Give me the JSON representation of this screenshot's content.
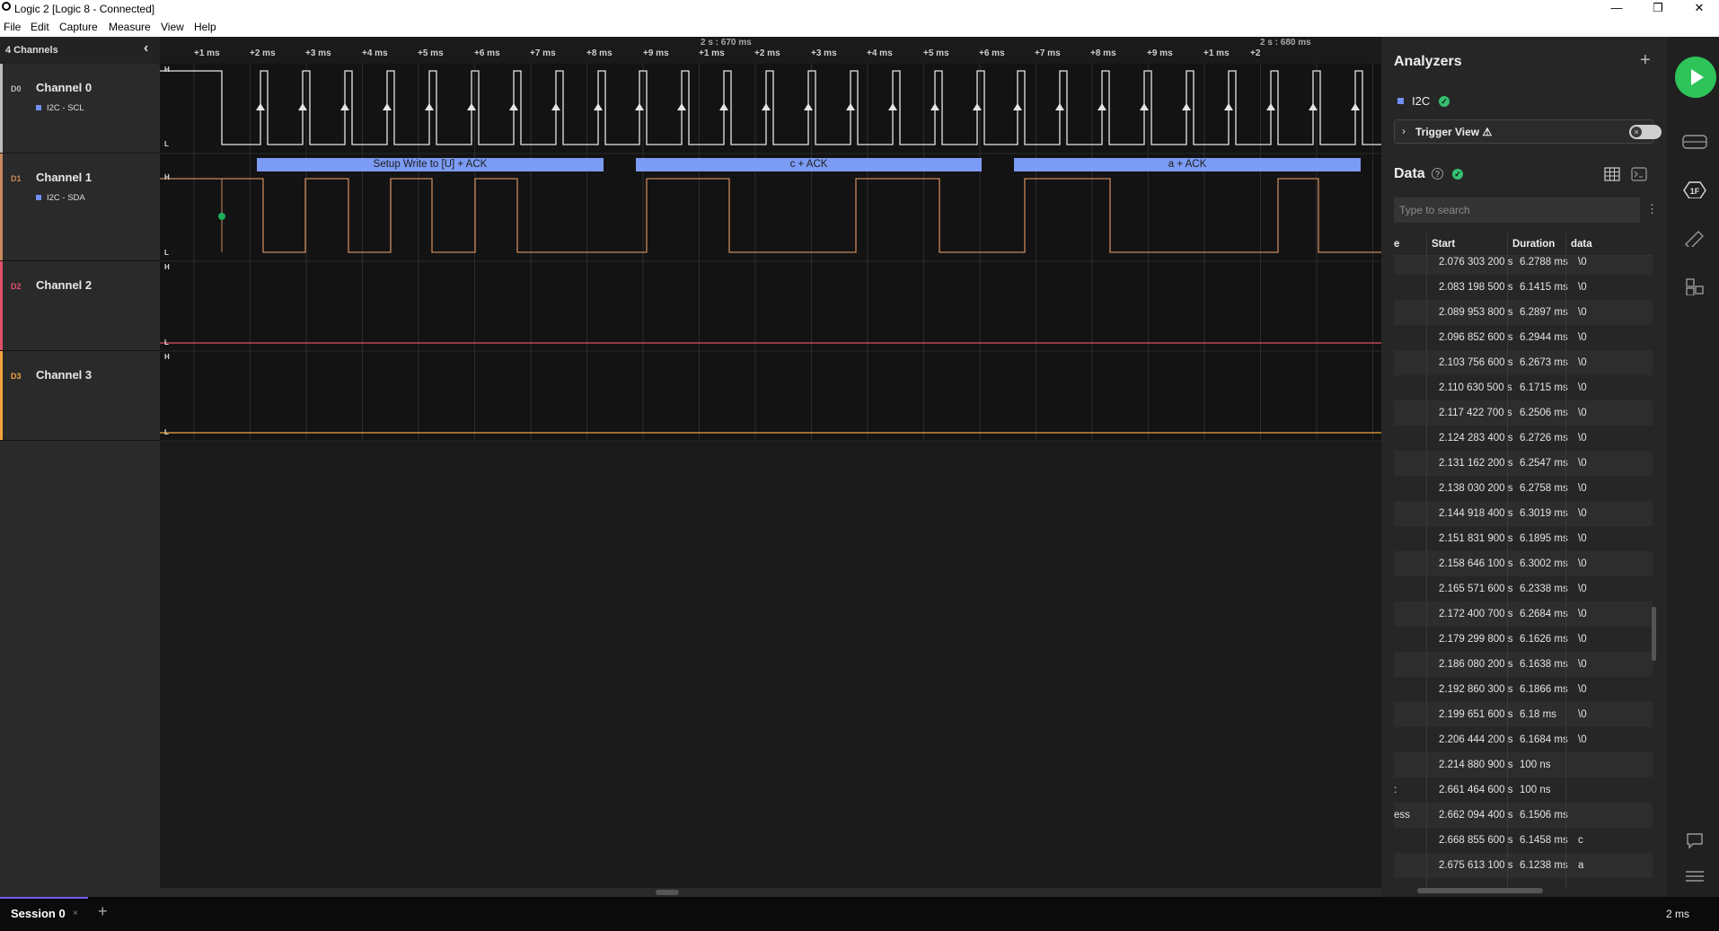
{
  "window": {
    "title": "Logic 2 [Logic 8 - Connected]",
    "minimize": "—",
    "restore": "❐",
    "close": "✕"
  },
  "menu": [
    "File",
    "Edit",
    "Capture",
    "Measure",
    "View",
    "Help"
  ],
  "channels_panel": {
    "header": "4 Channels",
    "channels": [
      {
        "code": "D0",
        "name": "Channel 0",
        "analyzer": "I2C - SCL",
        "color": "#bdbdbd"
      },
      {
        "code": "D1",
        "name": "Channel 1",
        "analyzer": "I2C - SDA",
        "color": "#c9885d"
      },
      {
        "code": "D2",
        "name": "Channel 2",
        "analyzer": "",
        "color": "#e0506a"
      },
      {
        "code": "D3",
        "name": "Channel 3",
        "analyzer": "",
        "color": "#f0a43a"
      }
    ]
  },
  "timeline": {
    "major": [
      "2 s : 670 ms",
      "2 s : 680 ms"
    ],
    "ticks": [
      "+1 ms",
      "+2 ms",
      "+3 ms",
      "+4 ms",
      "+5 ms",
      "+6 ms",
      "+7 ms",
      "+8 ms",
      "+9 ms",
      "+1 ms",
      "+2 ms",
      "+3 ms",
      "+4 ms",
      "+5 ms",
      "+6 ms",
      "+7 ms",
      "+8 ms",
      "+9 ms",
      "+1 ms",
      "+2"
    ],
    "level_high": "H",
    "level_low": "L"
  },
  "annotations": [
    "Setup Write to [U] + ACK",
    "c + ACK",
    "a + ACK"
  ],
  "analyzers_panel": {
    "title": "Analyzers",
    "add": "+",
    "analyzer_name": "I2C",
    "trigger_view": "Trigger View ⚠",
    "data_title": "Data",
    "help": "?",
    "search_placeholder": "Type to search"
  },
  "table": {
    "columns": [
      "e",
      "Start",
      "Duration",
      "data"
    ],
    "rows": [
      {
        "type": "",
        "start": "2.076 303 200 s",
        "duration": "6.2788 ms",
        "data": "\\0"
      },
      {
        "type": "",
        "start": "2.083 198 500 s",
        "duration": "6.1415 ms",
        "data": "\\0"
      },
      {
        "type": "",
        "start": "2.089 953 800 s",
        "duration": "6.2897 ms",
        "data": "\\0"
      },
      {
        "type": "",
        "start": "2.096 852 600 s",
        "duration": "6.2944 ms",
        "data": "\\0"
      },
      {
        "type": "",
        "start": "2.103 756 600 s",
        "duration": "6.2673 ms",
        "data": "\\0"
      },
      {
        "type": "",
        "start": "2.110 630 500 s",
        "duration": "6.1715 ms",
        "data": "\\0"
      },
      {
        "type": "",
        "start": "2.117 422 700 s",
        "duration": "6.2506 ms",
        "data": "\\0"
      },
      {
        "type": "",
        "start": "2.124 283 400 s",
        "duration": "6.2726 ms",
        "data": "\\0"
      },
      {
        "type": "",
        "start": "2.131 162 200 s",
        "duration": "6.2547 ms",
        "data": "\\0"
      },
      {
        "type": "",
        "start": "2.138 030 200 s",
        "duration": "6.2758 ms",
        "data": "\\0"
      },
      {
        "type": "",
        "start": "2.144 918 400 s",
        "duration": "6.3019 ms",
        "data": "\\0"
      },
      {
        "type": "",
        "start": "2.151 831 900 s",
        "duration": "6.1895 ms",
        "data": "\\0"
      },
      {
        "type": "",
        "start": "2.158 646 100 s",
        "duration": "6.3002 ms",
        "data": "\\0"
      },
      {
        "type": "",
        "start": "2.165 571 600 s",
        "duration": "6.2338 ms",
        "data": "\\0"
      },
      {
        "type": "",
        "start": "2.172 400 700 s",
        "duration": "6.2684 ms",
        "data": "\\0"
      },
      {
        "type": "",
        "start": "2.179 299 800 s",
        "duration": "6.1626 ms",
        "data": "\\0"
      },
      {
        "type": "",
        "start": "2.186 080 200 s",
        "duration": "6.1638 ms",
        "data": "\\0"
      },
      {
        "type": "",
        "start": "2.192 860 300 s",
        "duration": "6.1866 ms",
        "data": "\\0"
      },
      {
        "type": "",
        "start": "2.199 651 600 s",
        "duration": "6.18 ms",
        "data": "\\0"
      },
      {
        "type": "",
        "start": "2.206 444 200 s",
        "duration": "6.1684 ms",
        "data": "\\0"
      },
      {
        "type": "",
        "start": "2.214 880 900 s",
        "duration": "100 ns",
        "data": ""
      },
      {
        "type": ":",
        "start": "2.661 464 600 s",
        "duration": "100 ns",
        "data": ""
      },
      {
        "type": "ess",
        "start": "2.662 094 400 s",
        "duration": "6.1506 ms",
        "data": ""
      },
      {
        "type": "",
        "start": "2.668 855 600 s",
        "duration": "6.1458 ms",
        "data": "c"
      },
      {
        "type": "",
        "start": "2.675 613 100 s",
        "duration": "6.1238 ms",
        "data": "a"
      }
    ]
  },
  "bottom": {
    "session": "Session 0",
    "close": "×",
    "add": "+",
    "timescale": "2 ms"
  },
  "colors": {
    "accent": "#2ec45a",
    "annotation": "#7c9bf4",
    "session_indicator": "#7b5cff"
  }
}
